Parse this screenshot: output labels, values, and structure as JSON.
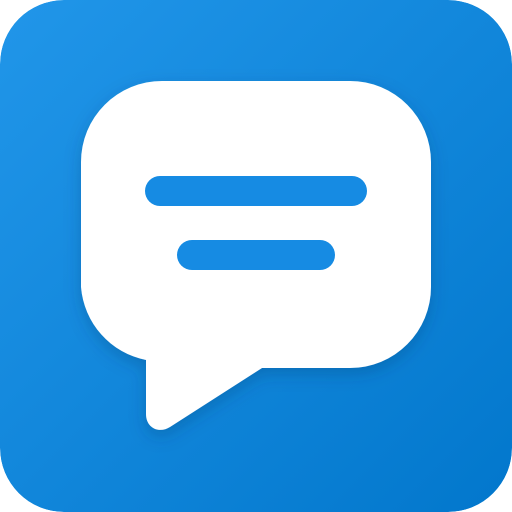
{
  "icon": {
    "name": "chat-bubble-icon",
    "colors": {
      "gradient_start": "#2196E9",
      "gradient_end": "#0277CC",
      "bubble": "#FFFFFF",
      "lines": "#168BE3"
    }
  }
}
